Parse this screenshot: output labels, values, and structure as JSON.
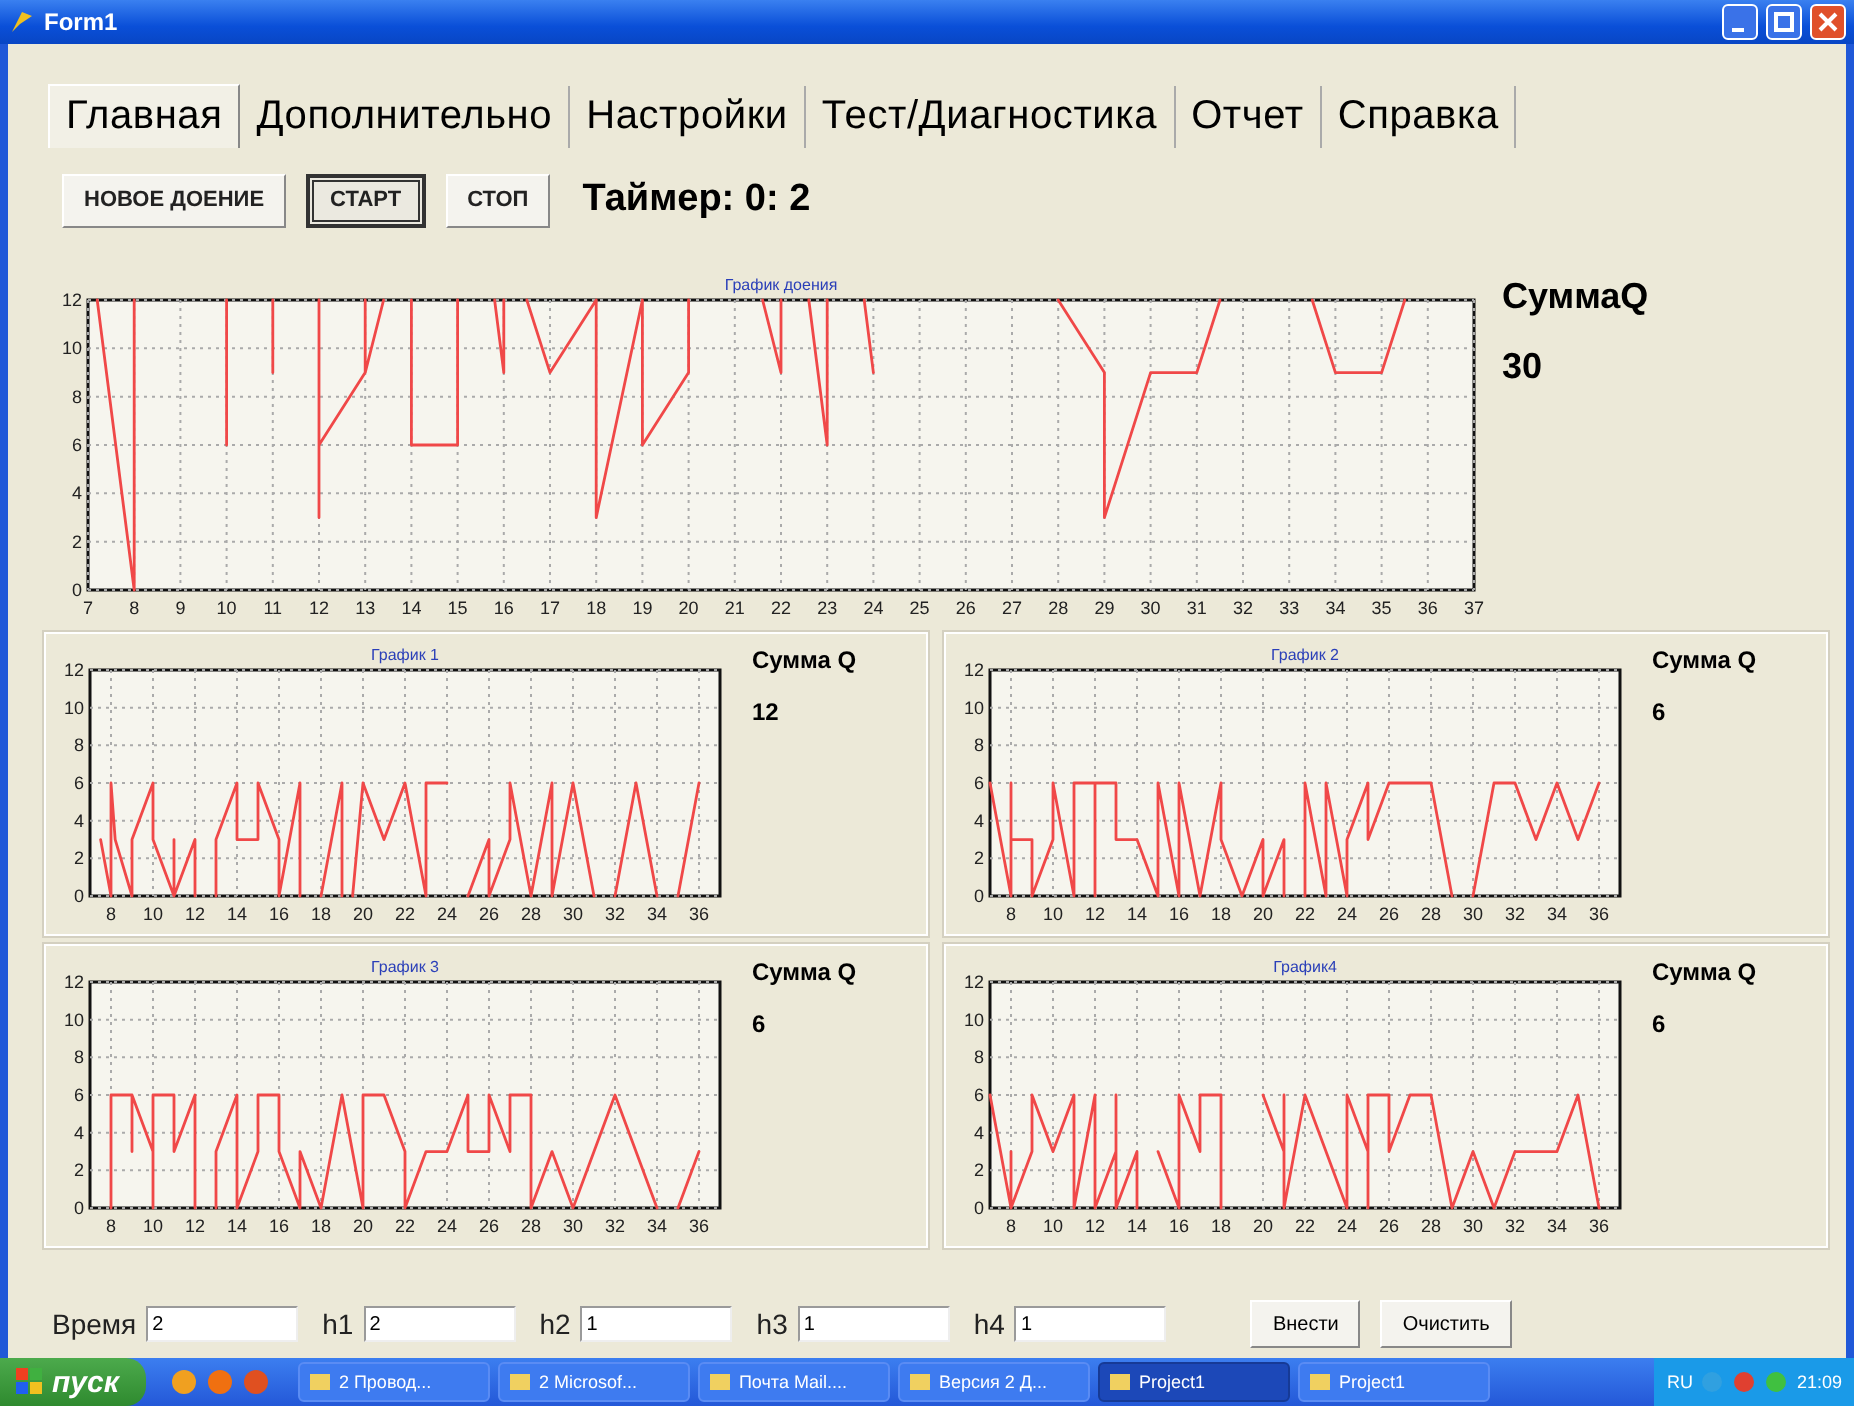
{
  "window": {
    "title": "Form1"
  },
  "tabs": [
    {
      "label": "Главная",
      "selected": true
    },
    {
      "label": "Дополнительно",
      "selected": false
    },
    {
      "label": "Настройки",
      "selected": false
    },
    {
      "label": "Тест/Диагностика",
      "selected": false
    },
    {
      "label": "Отчет",
      "selected": false
    },
    {
      "label": "Справка",
      "selected": false
    }
  ],
  "toolbar": {
    "buttons": [
      {
        "label": "НОВОЕ ДОЕНИЕ",
        "default": false
      },
      {
        "label": "СТАРТ",
        "default": true
      },
      {
        "label": "СТОП",
        "default": false
      }
    ],
    "timer": "Таймер: 0: 2"
  },
  "main_chart": {
    "sum_label": "СуммаQ",
    "sum_value": "30",
    "chart_data": {
      "type": "line",
      "grid": true,
      "title": "График доения",
      "xlim": [
        7,
        37
      ],
      "ylim": [
        0,
        12
      ],
      "xticks": [
        7,
        8,
        9,
        10,
        11,
        12,
        13,
        14,
        15,
        16,
        17,
        18,
        19,
        20,
        21,
        22,
        23,
        24,
        25,
        26,
        27,
        28,
        29,
        30,
        31,
        32,
        33,
        34,
        35,
        36,
        37
      ],
      "yticks": [
        0,
        2,
        4,
        6,
        8,
        10,
        12
      ],
      "x": [
        7.2,
        8,
        8,
        null,
        10,
        10,
        null,
        11,
        11,
        null,
        12,
        12,
        12,
        13,
        13.4,
        null,
        13,
        13,
        null,
        14,
        14,
        15,
        15,
        null,
        15.8,
        16,
        16,
        null,
        16.5,
        17,
        18,
        18,
        19,
        19,
        20,
        20,
        null,
        21.6,
        22,
        22,
        null,
        22.6,
        23,
        23,
        null,
        23.8,
        24,
        null,
        28,
        29,
        29,
        30,
        31,
        31.5,
        null,
        33.5,
        34,
        35,
        35.5
      ],
      "values": [
        12,
        0,
        12,
        null,
        12,
        6,
        null,
        12,
        9,
        null,
        12,
        3,
        6,
        9,
        12,
        null,
        12,
        9,
        null,
        12,
        6,
        6,
        12,
        null,
        12,
        9,
        12,
        null,
        12,
        9,
        12,
        3,
        12,
        6,
        9,
        12,
        null,
        12,
        9,
        12,
        null,
        12,
        6,
        12,
        null,
        12,
        9,
        null,
        12,
        9,
        3,
        9,
        9,
        12,
        null,
        12,
        9,
        9,
        12
      ]
    }
  },
  "charts": [
    {
      "sum_label": "Сумма Q",
      "sum_value": "12",
      "chart_data": {
        "type": "line",
        "grid": true,
        "title": "График 1",
        "xlim": [
          7,
          37
        ],
        "ylim": [
          0,
          12
        ],
        "xticks": [
          8,
          10,
          12,
          14,
          16,
          18,
          20,
          22,
          24,
          26,
          28,
          30,
          32,
          34,
          36
        ],
        "yticks": [
          0,
          2,
          4,
          6,
          8,
          10,
          12
        ],
        "x": [
          7.5,
          8,
          8,
          8.2,
          9,
          9,
          10,
          10,
          11,
          11,
          11,
          12,
          12,
          null,
          13,
          13,
          14,
          14,
          15,
          15,
          16,
          16,
          17,
          17,
          null,
          18,
          19,
          19,
          null,
          19.5,
          20,
          21,
          22,
          23,
          23,
          24,
          null,
          25,
          26,
          26,
          27,
          27,
          28,
          29,
          29,
          30,
          31,
          null,
          32,
          33,
          34,
          null,
          35,
          36
        ],
        "values": [
          3,
          0,
          6,
          3,
          0,
          3,
          6,
          3,
          0,
          3,
          0,
          3,
          0,
          null,
          0,
          3,
          6,
          3,
          3,
          6,
          3,
          0,
          6,
          0,
          null,
          0,
          6,
          0,
          null,
          0,
          6,
          3,
          6,
          0,
          6,
          6,
          null,
          0,
          3,
          0,
          3,
          6,
          0,
          6,
          0,
          6,
          0,
          null,
          0,
          6,
          0,
          null,
          0,
          6
        ]
      }
    },
    {
      "sum_label": "Сумма Q",
      "sum_value": "6",
      "chart_data": {
        "type": "line",
        "grid": true,
        "title": "График 2",
        "xlim": [
          7,
          37
        ],
        "ylim": [
          0,
          12
        ],
        "xticks": [
          8,
          10,
          12,
          14,
          16,
          18,
          20,
          22,
          24,
          26,
          28,
          30,
          32,
          34,
          36
        ],
        "yticks": [
          0,
          2,
          4,
          6,
          8,
          10,
          12
        ],
        "x": [
          7,
          8,
          8,
          8,
          9,
          9,
          10,
          10,
          11,
          11,
          12,
          12,
          12,
          13,
          13,
          14,
          15,
          15,
          16,
          16,
          17,
          18,
          18,
          19,
          20,
          20,
          21,
          21,
          null,
          22,
          22,
          23,
          23,
          24,
          24,
          25,
          25,
          26,
          28,
          29,
          null,
          30,
          31,
          32,
          33,
          34,
          35,
          36
        ],
        "values": [
          6,
          0,
          6,
          3,
          3,
          0,
          3,
          6,
          0,
          6,
          6,
          0,
          6,
          6,
          3,
          3,
          0,
          6,
          0,
          6,
          0,
          6,
          3,
          0,
          3,
          0,
          3,
          0,
          null,
          0,
          6,
          0,
          6,
          0,
          3,
          6,
          3,
          6,
          6,
          0,
          null,
          0,
          6,
          6,
          3,
          6,
          3,
          6
        ]
      }
    },
    {
      "sum_label": "Сумма Q",
      "sum_value": "6",
      "chart_data": {
        "type": "line",
        "grid": true,
        "title": "График 3",
        "xlim": [
          7,
          37
        ],
        "ylim": [
          0,
          12
        ],
        "xticks": [
          8,
          10,
          12,
          14,
          16,
          18,
          20,
          22,
          24,
          26,
          28,
          30,
          32,
          34,
          36
        ],
        "yticks": [
          0,
          2,
          4,
          6,
          8,
          10,
          12
        ],
        "x": [
          8,
          8,
          9,
          9,
          9,
          10,
          10,
          10,
          11,
          11,
          12,
          12,
          null,
          13,
          13,
          14,
          14,
          15,
          15,
          16,
          16,
          17,
          17,
          18,
          19,
          20,
          20,
          21,
          22,
          22,
          23,
          24,
          25,
          25,
          26,
          26,
          27,
          27,
          28,
          28,
          29,
          30,
          32,
          34,
          null,
          35,
          36
        ],
        "values": [
          0,
          6,
          6,
          3,
          6,
          3,
          0,
          6,
          6,
          3,
          6,
          0,
          null,
          0,
          3,
          6,
          0,
          3,
          6,
          6,
          3,
          0,
          3,
          0,
          6,
          0,
          6,
          6,
          3,
          0,
          3,
          3,
          6,
          3,
          3,
          6,
          3,
          6,
          6,
          0,
          3,
          0,
          6,
          0,
          null,
          0,
          3
        ]
      }
    },
    {
      "sum_label": "Сумма Q",
      "sum_value": "6",
      "chart_data": {
        "type": "line",
        "grid": true,
        "title": "График4",
        "xlim": [
          7,
          37
        ],
        "ylim": [
          0,
          12
        ],
        "xticks": [
          8,
          10,
          12,
          14,
          16,
          18,
          20,
          22,
          24,
          26,
          28,
          30,
          32,
          34,
          36
        ],
        "yticks": [
          0,
          2,
          4,
          6,
          8,
          10,
          12
        ],
        "x": [
          7,
          8,
          8,
          null,
          8,
          9,
          9,
          10,
          11,
          11,
          12,
          12,
          13,
          13,
          13,
          14,
          14,
          null,
          15,
          16,
          16,
          17,
          17,
          18,
          18,
          null,
          20,
          21,
          21,
          21,
          22,
          24,
          24,
          25,
          25,
          25,
          26,
          26,
          27,
          28,
          29,
          30,
          31,
          32,
          34,
          35,
          36
        ],
        "values": [
          6,
          0,
          3,
          null,
          0,
          3,
          6,
          3,
          6,
          0,
          6,
          0,
          3,
          6,
          0,
          3,
          0,
          null,
          3,
          0,
          6,
          3,
          6,
          6,
          0,
          null,
          6,
          3,
          6,
          0,
          6,
          0,
          6,
          3,
          0,
          6,
          6,
          3,
          6,
          6,
          0,
          3,
          0,
          3,
          3,
          6,
          0
        ]
      }
    }
  ],
  "inputs": {
    "fields": [
      {
        "label": "Время",
        "value": "2"
      },
      {
        "label": "h1",
        "value": "2"
      },
      {
        "label": "h2",
        "value": "1"
      },
      {
        "label": "h3",
        "value": "1"
      },
      {
        "label": "h4",
        "value": "1"
      }
    ],
    "buttons": [
      "Внести",
      "Очистить"
    ]
  },
  "taskbar": {
    "start": "пуск",
    "items": [
      {
        "label": "2 Провод...",
        "selected": false
      },
      {
        "label": "2 Microsof...",
        "selected": false
      },
      {
        "label": "Почта Mail....",
        "selected": false
      },
      {
        "label": "Версия 2 Д...",
        "selected": false
      },
      {
        "label": "Project1",
        "selected": true
      },
      {
        "label": "Project1",
        "selected": false
      }
    ],
    "language": "RU",
    "clock": "21:09"
  }
}
